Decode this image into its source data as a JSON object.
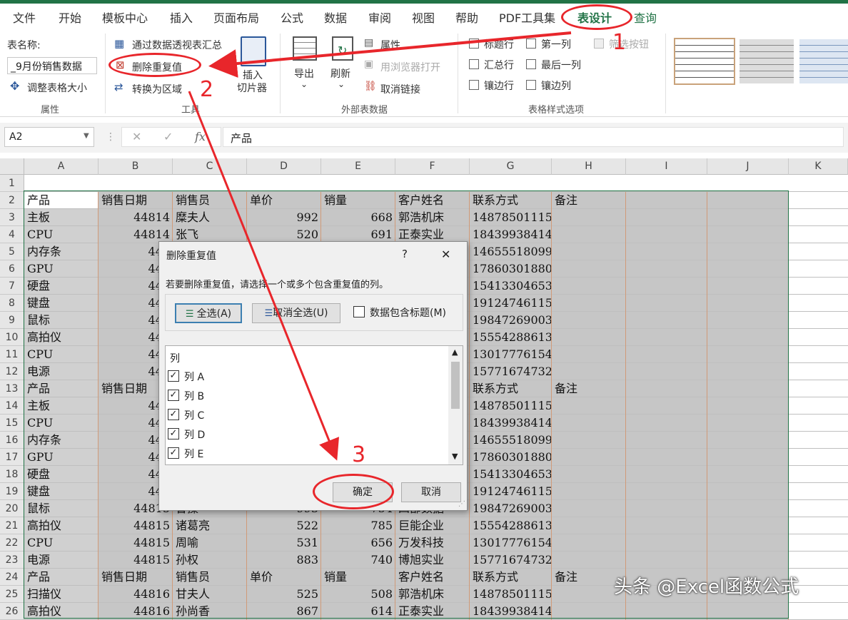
{
  "menu": {
    "tabs": [
      "文件",
      "开始",
      "模板中心",
      "插入",
      "页面布局",
      "公式",
      "数据",
      "审阅",
      "视图",
      "帮助",
      "PDF工具集",
      "表设计",
      "查询"
    ],
    "active_tab": "表设计"
  },
  "ribbon": {
    "table_name_label": "表名称:",
    "table_name_value": "_9月份销售数据",
    "resize_table": "调整表格大小",
    "group_properties": "属性",
    "summarize_pivot": "通过数据透视表汇总",
    "remove_duplicates": "删除重复值",
    "convert_to_range": "转换为区域",
    "insert_slicer_1": "插入",
    "insert_slicer_2": "切片器",
    "group_tools": "工具",
    "export": "导出",
    "refresh": "刷新",
    "properties": "属性",
    "open_in_browser": "用浏览器打开",
    "unlink": "取消链接",
    "group_external": "外部表数据",
    "header_row": "标题行",
    "first_column": "第一列",
    "filter_button": "筛选按钮",
    "total_row": "汇总行",
    "last_column": "最后一列",
    "banded_rows": "镶边行",
    "banded_columns": "镶边列",
    "group_style_options": "表格样式选项"
  },
  "formula_bar": {
    "name_box": "A2",
    "formula": "产品"
  },
  "sheet": {
    "columns": [
      "A",
      "B",
      "C",
      "D",
      "E",
      "F",
      "G",
      "H",
      "I",
      "J",
      "K"
    ],
    "rows": [
      {
        "n": "1",
        "a": "",
        "b": "",
        "c": "",
        "d": "",
        "e": "",
        "f": "",
        "g": "",
        "h": ""
      },
      {
        "n": "2",
        "a": "产品",
        "b": "销售日期",
        "c": "销售员",
        "d": "单价",
        "e": "销量",
        "f": "客户姓名",
        "g": "联系方式",
        "h": "备注"
      },
      {
        "n": "3",
        "a": "主板",
        "b": "44814",
        "c": "糜夫人",
        "d": "992",
        "e": "668",
        "f": "郭浩机床",
        "g": "14878501115",
        "h": ""
      },
      {
        "n": "4",
        "a": "CPU",
        "b": "44814",
        "c": "张飞",
        "d": "520",
        "e": "691",
        "f": "正泰实业",
        "g": "18439938414",
        "h": ""
      },
      {
        "n": "5",
        "a": "内存条",
        "b": "448",
        "c": "",
        "d": "",
        "e": "",
        "f": "",
        "g": "14655518099",
        "h": ""
      },
      {
        "n": "6",
        "a": "GPU",
        "b": "448",
        "c": "",
        "d": "",
        "e": "",
        "f": "",
        "g": "17860301880",
        "h": ""
      },
      {
        "n": "7",
        "a": "硬盘",
        "b": "448",
        "c": "",
        "d": "",
        "e": "",
        "f": "",
        "g": "15413304653",
        "h": ""
      },
      {
        "n": "8",
        "a": "键盘",
        "b": "448",
        "c": "",
        "d": "",
        "e": "",
        "f": "",
        "g": "19124746115",
        "h": ""
      },
      {
        "n": "9",
        "a": "鼠标",
        "b": "448",
        "c": "",
        "d": "",
        "e": "",
        "f": "",
        "g": "19847269003",
        "h": ""
      },
      {
        "n": "10",
        "a": "高拍仪",
        "b": "448",
        "c": "",
        "d": "",
        "e": "",
        "f": "",
        "g": "15554288613",
        "h": ""
      },
      {
        "n": "11",
        "a": "CPU",
        "b": "448",
        "c": "",
        "d": "",
        "e": "",
        "f": "",
        "g": "13017776154",
        "h": ""
      },
      {
        "n": "12",
        "a": "电源",
        "b": "448",
        "c": "",
        "d": "",
        "e": "",
        "f": "",
        "g": "15771674732",
        "h": ""
      },
      {
        "n": "13",
        "a": "产品",
        "b": "销售日期",
        "c": "",
        "d": "",
        "e": "",
        "f": "",
        "g": "联系方式",
        "h": "备注"
      },
      {
        "n": "14",
        "a": "主板",
        "b": "448",
        "c": "",
        "d": "",
        "e": "",
        "f": "",
        "g": "14878501115",
        "h": ""
      },
      {
        "n": "15",
        "a": "CPU",
        "b": "448",
        "c": "",
        "d": "",
        "e": "",
        "f": "",
        "g": "18439938414",
        "h": ""
      },
      {
        "n": "16",
        "a": "内存条",
        "b": "448",
        "c": "",
        "d": "",
        "e": "",
        "f": "",
        "g": "14655518099",
        "h": ""
      },
      {
        "n": "17",
        "a": "GPU",
        "b": "448",
        "c": "",
        "d": "",
        "e": "",
        "f": "",
        "g": "17860301880",
        "h": ""
      },
      {
        "n": "18",
        "a": "硬盘",
        "b": "448",
        "c": "",
        "d": "",
        "e": "",
        "f": "",
        "g": "15413304653",
        "h": ""
      },
      {
        "n": "19",
        "a": "键盘",
        "b": "448",
        "c": "",
        "d": "",
        "e": "",
        "f": "",
        "g": "19124746115",
        "h": ""
      },
      {
        "n": "20",
        "a": "鼠标",
        "b": "44815",
        "c": "曹操",
        "d": "993",
        "e": "754",
        "f": "四部数据",
        "g": "19847269003",
        "h": ""
      },
      {
        "n": "21",
        "a": "高拍仪",
        "b": "44815",
        "c": "诸葛亮",
        "d": "522",
        "e": "785",
        "f": "巨能企业",
        "g": "15554288613",
        "h": ""
      },
      {
        "n": "22",
        "a": "CPU",
        "b": "44815",
        "c": "周喻",
        "d": "531",
        "e": "656",
        "f": "万发科技",
        "g": "13017776154",
        "h": ""
      },
      {
        "n": "23",
        "a": "电源",
        "b": "44815",
        "c": "孙权",
        "d": "883",
        "e": "740",
        "f": "博旭实业",
        "g": "15771674732",
        "h": ""
      },
      {
        "n": "24",
        "a": "产品",
        "b": "销售日期",
        "c": "销售员",
        "d": "单价",
        "e": "销量",
        "f": "客户姓名",
        "g": "联系方式",
        "h": "备注"
      },
      {
        "n": "25",
        "a": "扫描仪",
        "b": "44816",
        "c": "甘夫人",
        "d": "525",
        "e": "508",
        "f": "郭浩机床",
        "g": "14878501115",
        "h": ""
      },
      {
        "n": "26",
        "a": "高拍仪",
        "b": "44816",
        "c": "孙尚香",
        "d": "867",
        "e": "614",
        "f": "正泰实业",
        "g": "18439938414",
        "h": ""
      }
    ]
  },
  "dialog": {
    "title": "删除重复值",
    "help": "?",
    "close": "✕",
    "instruction": "若要删除重复值，请选择一个或多个包含重复值的列。",
    "select_all": "全选(A)",
    "unselect_all": "取消全选(U)",
    "has_headers": "数据包含标题(M)",
    "list_header": "列",
    "columns": [
      "列 A",
      "列 B",
      "列 C",
      "列 D",
      "列 E"
    ],
    "ok": "确定",
    "cancel": "取消"
  },
  "annotations": {
    "step1": "1",
    "step2": "2",
    "step3": "3",
    "color": "#e8262b"
  },
  "watermark": "头条 @Excel函数公式"
}
